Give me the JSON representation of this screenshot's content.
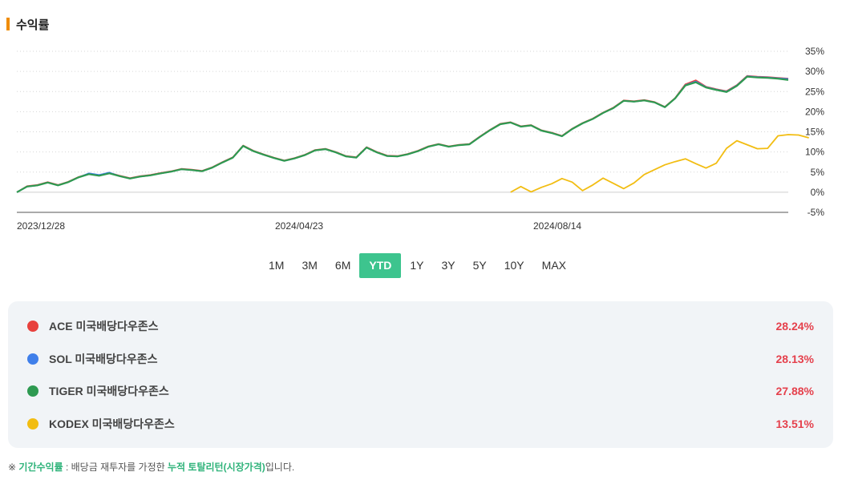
{
  "section": {
    "title": "수익률"
  },
  "periods": [
    "1M",
    "3M",
    "6M",
    "YTD",
    "1Y",
    "3Y",
    "5Y",
    "10Y",
    "MAX"
  ],
  "active_period": "YTD",
  "legend": [
    {
      "name": "ACE 미국배당다우존스",
      "value": "28.24%",
      "color": "#e8413d"
    },
    {
      "name": "SOL 미국배당다우존스",
      "value": "28.13%",
      "color": "#3f7fea"
    },
    {
      "name": "TIGER 미국배당다우존스",
      "value": "27.88%",
      "color": "#2e9a51"
    },
    {
      "name": "KODEX 미국배당다우존스",
      "value": "13.51%",
      "color": "#f2bd12"
    }
  ],
  "footnote": {
    "mark": "※",
    "term": "기간수익률",
    "sep": " : 배당금 재투자를 가정한 ",
    "highlight": "누적 토탈리턴(시장가격)",
    "tail": "입니다."
  },
  "chart_data": {
    "type": "line",
    "x_labels": [
      "2023/12/28",
      "2024/04/23",
      "2024/08/14"
    ],
    "y_ticks": [
      "35%",
      "30%",
      "25%",
      "20%",
      "15%",
      "10%",
      "5%",
      "0%",
      "-5%"
    ],
    "ylim": [
      -5,
      35
    ],
    "grid": true,
    "series": [
      {
        "name": "ACE 미국배당다우존스",
        "color": "#e8413d",
        "values": [
          0,
          1.5,
          1.8,
          2.5,
          1.8,
          2.6,
          3.8,
          4.6,
          4.2,
          4.8,
          4.1,
          3.5,
          4.0,
          4.3,
          4.8,
          5.2,
          5.8,
          5.6,
          5.3,
          6.2,
          7.5,
          8.7,
          11.6,
          10.3,
          9.4,
          8.6,
          7.9,
          8.5,
          9.3,
          10.5,
          10.8,
          10.0,
          9.0,
          8.7,
          11.2,
          10.0,
          9.1,
          9.0,
          9.5,
          10.3,
          11.4,
          12.0,
          11.4,
          11.8,
          12.0,
          13.8,
          15.5,
          17.0,
          17.4,
          16.4,
          16.7,
          15.4,
          14.8,
          14.0,
          15.8,
          17.2,
          18.3,
          19.8,
          21.0,
          22.8,
          22.6,
          22.9,
          22.4,
          21.2,
          23.4,
          26.8,
          27.8,
          26.2,
          25.6,
          25.1,
          26.6,
          28.9,
          28.7,
          28.6,
          28.4,
          28.24
        ]
      },
      {
        "name": "SOL 미국배당다우존스",
        "color": "#3f7fea",
        "values": [
          0,
          1.4,
          1.7,
          2.4,
          1.7,
          2.5,
          3.7,
          4.7,
          4.3,
          4.9,
          4.0,
          3.4,
          3.9,
          4.2,
          4.7,
          5.1,
          5.7,
          5.5,
          5.2,
          6.1,
          7.4,
          8.6,
          11.5,
          10.2,
          9.3,
          8.5,
          7.8,
          8.4,
          9.2,
          10.4,
          10.7,
          9.9,
          8.9,
          8.6,
          11.1,
          9.9,
          9.0,
          8.9,
          9.4,
          10.2,
          11.3,
          11.9,
          11.3,
          11.7,
          11.9,
          13.7,
          15.4,
          16.9,
          17.3,
          16.3,
          16.6,
          15.3,
          14.7,
          13.9,
          15.7,
          17.1,
          18.2,
          19.7,
          20.9,
          22.7,
          22.5,
          22.8,
          22.3,
          21.1,
          23.3,
          26.6,
          27.5,
          26.1,
          25.5,
          25.0,
          26.5,
          28.8,
          28.6,
          28.5,
          28.3,
          28.13
        ]
      },
      {
        "name": "TIGER 미국배당다우존스",
        "color": "#2e9a51",
        "values": [
          0,
          1.4,
          1.7,
          2.4,
          1.7,
          2.5,
          3.7,
          4.5,
          4.1,
          4.7,
          4.0,
          3.4,
          3.9,
          4.2,
          4.7,
          5.1,
          5.7,
          5.5,
          5.2,
          6.1,
          7.4,
          8.6,
          11.5,
          10.2,
          9.3,
          8.5,
          7.8,
          8.4,
          9.2,
          10.4,
          10.7,
          9.9,
          8.9,
          8.6,
          11.1,
          9.9,
          9.0,
          8.9,
          9.4,
          10.2,
          11.3,
          11.9,
          11.3,
          11.7,
          11.9,
          13.7,
          15.4,
          16.9,
          17.3,
          16.3,
          16.6,
          15.3,
          14.7,
          13.9,
          15.7,
          17.1,
          18.2,
          19.7,
          20.9,
          22.7,
          22.5,
          22.8,
          22.3,
          21.1,
          23.3,
          26.5,
          27.3,
          26.0,
          25.4,
          24.9,
          26.4,
          28.7,
          28.5,
          28.4,
          28.2,
          27.88
        ]
      },
      {
        "name": "KODEX 미국배당다우존스",
        "color": "#f2bd12",
        "start_index": 48,
        "values": [
          0,
          1.4,
          0.1,
          1.2,
          2.1,
          3.4,
          2.5,
          0.4,
          1.8,
          3.5,
          2.2,
          0.9,
          2.3,
          4.4,
          5.6,
          6.8,
          7.6,
          8.3,
          7.1,
          6.0,
          7.2,
          10.9,
          12.8,
          11.8,
          10.8,
          10.9,
          14.0,
          14.3,
          14.2,
          13.51
        ]
      }
    ]
  }
}
